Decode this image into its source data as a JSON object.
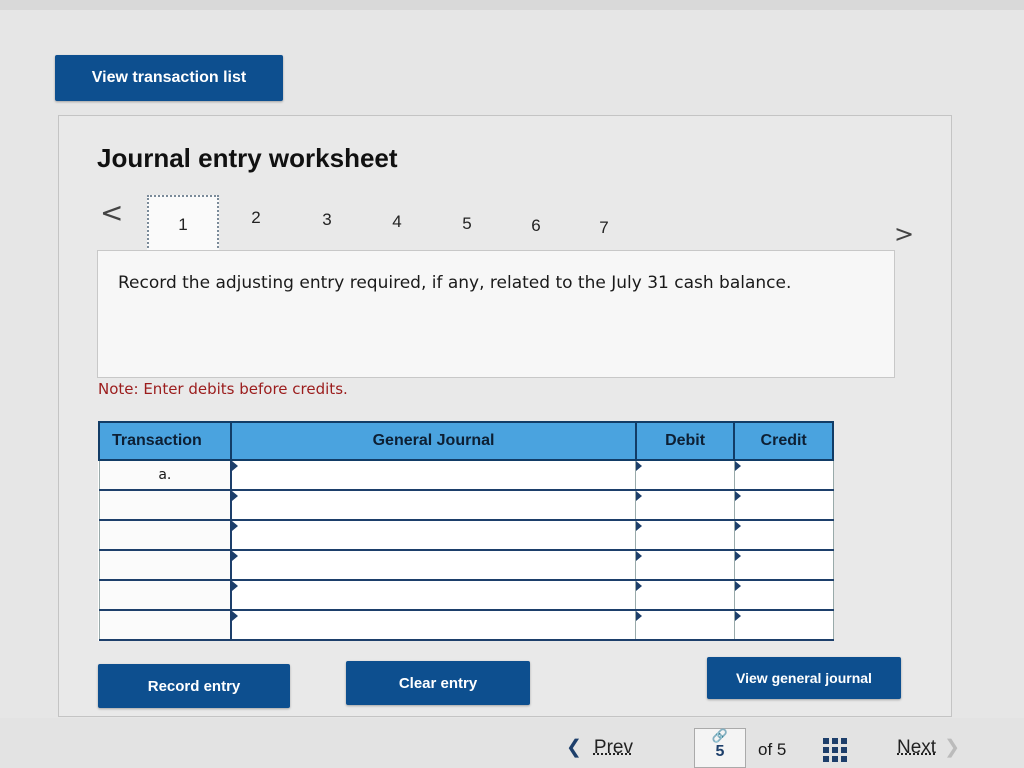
{
  "toolbar": {
    "view_transaction_list": "View transaction list"
  },
  "worksheet": {
    "title": "Journal entry worksheet",
    "prev_arrow": "<",
    "next_arrow": ">",
    "steps": [
      "1",
      "2",
      "3",
      "4",
      "5",
      "6",
      "7"
    ],
    "active_step": "1",
    "instruction": "Record the adjusting entry required, if any, related to the July 31 cash balance.",
    "note": "Note: Enter debits before credits."
  },
  "table": {
    "headers": {
      "transaction": "Transaction",
      "general_journal": "General Journal",
      "debit": "Debit",
      "credit": "Credit"
    },
    "rows": [
      {
        "transaction": "a."
      },
      {
        "transaction": ""
      },
      {
        "transaction": ""
      },
      {
        "transaction": ""
      },
      {
        "transaction": ""
      },
      {
        "transaction": ""
      }
    ]
  },
  "actions": {
    "record_entry": "Record entry",
    "clear_entry": "Clear entry",
    "view_general_journal": "View general journal"
  },
  "pager": {
    "prev": "Prev",
    "current_page": "5",
    "of_text": "of 5",
    "next": "Next"
  },
  "colors": {
    "button_bg": "#0d4f8f",
    "table_header_bg": "#4aa3df",
    "note_color": "#9b1c1c"
  }
}
